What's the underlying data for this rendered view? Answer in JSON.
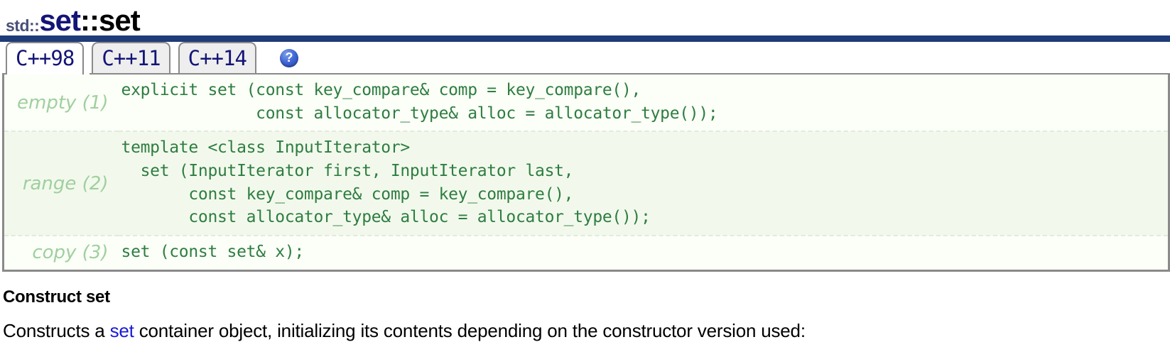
{
  "title": {
    "namespace": "std::",
    "class": "set",
    "separator": "::",
    "member": "set"
  },
  "tabs": [
    {
      "label": "C++98",
      "active": true
    },
    {
      "label": "C++11",
      "active": false
    },
    {
      "label": "C++14",
      "active": false
    }
  ],
  "help": {
    "icon": "question-mark-icon",
    "glyph": "?"
  },
  "signatures": [
    {
      "label": "empty (1)",
      "code": "explicit set (const key_compare& comp = key_compare(),\n              const allocator_type& alloc = allocator_type());"
    },
    {
      "label": "range (2)",
      "code": "template <class InputIterator>\n  set (InputIterator first, InputIterator last,\n       const key_compare& comp = key_compare(),\n       const allocator_type& alloc = allocator_type());"
    },
    {
      "label": "copy (3)",
      "code": "set (const set& x);"
    }
  ],
  "description": {
    "heading": "Construct set",
    "paragraph_prefix": "Constructs a ",
    "paragraph_link": "set",
    "paragraph_suffix": " container object, initializing its contents depending on the constructor version used:"
  },
  "colors": {
    "rule": "#1f3c79",
    "code_green": "#2e7d41",
    "label_green": "#a0cfa0",
    "link_blue": "#1a1ad6",
    "title_navy": "#141478",
    "namespace_slate": "#4a4f7a"
  }
}
